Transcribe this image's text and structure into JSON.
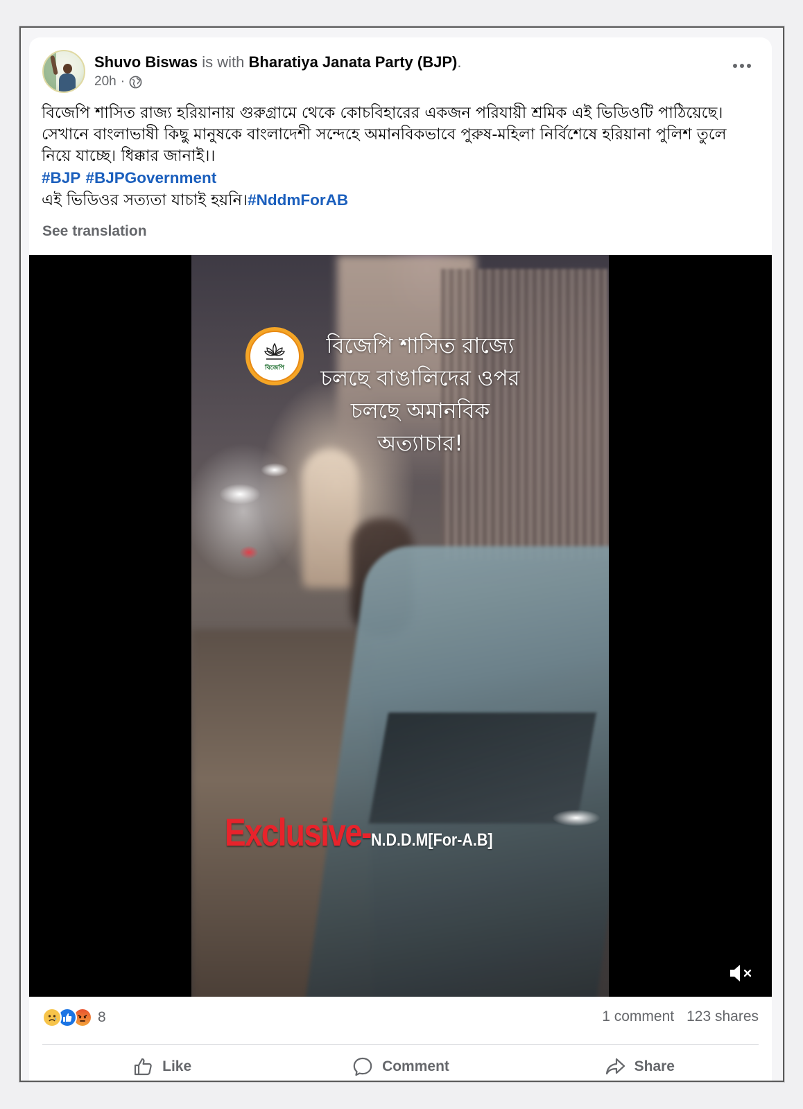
{
  "post": {
    "author": "Shuvo Biswas",
    "with_text": "is with",
    "tagged_page": "Bharatiya Janata Party (BJP)",
    "tagged_suffix": ".",
    "time": "20h",
    "time_sep": "·",
    "privacy_icon": "globe-icon",
    "text_line1": "বিজেপি শাসিত রাজ্য হরিয়ানায় গুরুগ্রামে থেকে কোচবিহারের একজন পরিযায়ী শ্রমিক এই ভিডিওটি পাঠিয়েছে।",
    "text_line2": "সেখানে বাংলাভাষী কিছু মানুষকে বাংলাদেশী সন্দেহে অমানবিকভাবে পুরুষ-মহিলা নির্বিশেষে হরিয়ানা পুলিশ তুলে নিয়ে যাচ্ছে। ধিক্কার জানাই।।",
    "hashtag1": "#BJP",
    "hashtag2": "#BJPGovernment",
    "text_line4": "এই ভিডিওর সত্যতা যাচাই হয়নি।",
    "hashtag3": "#NddmForAB",
    "see_translation": "See translation"
  },
  "video": {
    "overlay_line1": "বিজেপি শাসিত রাজ্যে",
    "overlay_line2": "চলছে বাঙালিদের ওপর",
    "overlay_line3": "চলছে অমানবিক",
    "overlay_line4": "অত্যাচার!",
    "logo_text": "বিজেপি",
    "exclusive_red": "Exclusive-",
    "exclusive_white": "N.D.D.M[For-A.B]",
    "mute_icon": "muted-speaker-icon"
  },
  "footer": {
    "reaction_icons": [
      "sad-reaction-icon",
      "like-reaction-icon",
      "angry-reaction-icon"
    ],
    "reaction_count": "8",
    "comments": "1 comment",
    "shares": "123 shares",
    "like_label": "Like",
    "comment_label": "Comment",
    "share_label": "Share"
  },
  "colors": {
    "hashtag": "#1b5fbd",
    "muted_text": "#65676b",
    "exclusive_red": "#e8232b",
    "bjp_saffron": "#f4a526"
  }
}
